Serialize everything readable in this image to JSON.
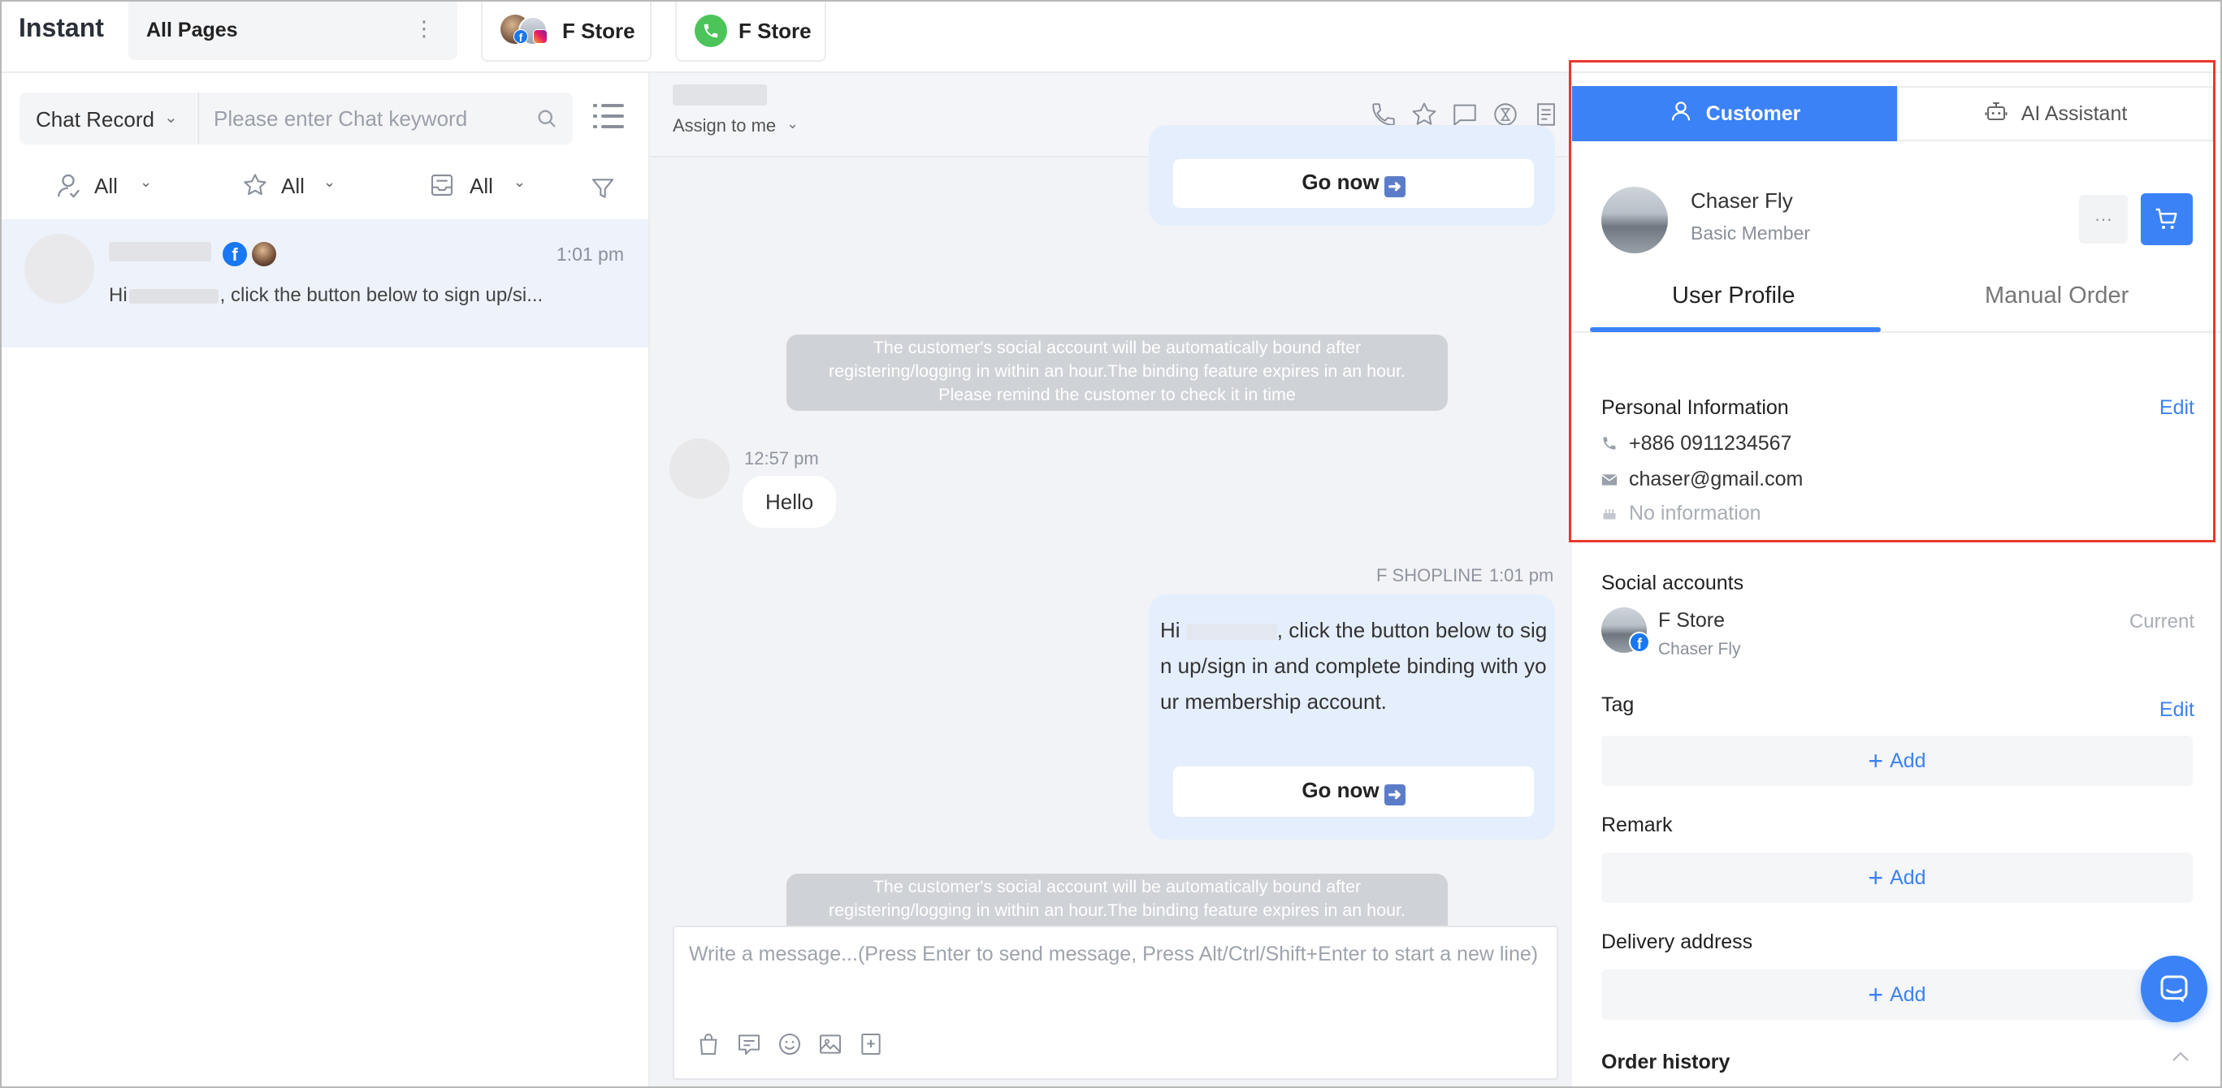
{
  "app": {
    "title": "Instant"
  },
  "page_selector": {
    "label": "All Pages",
    "more": "⋮"
  },
  "store_tabs": [
    {
      "label": "F Store",
      "channels": [
        "facebook",
        "instagram"
      ]
    },
    {
      "label": "F Store",
      "channels": [
        "whatsapp"
      ]
    }
  ],
  "sidebar": {
    "mode_select": "Chat Record",
    "search": {
      "placeholder": "Please enter Chat keyword",
      "value": ""
    },
    "filters": [
      {
        "icon": "user-icon",
        "label": "All"
      },
      {
        "icon": "star-icon",
        "label": "All"
      },
      {
        "icon": "inbox-icon",
        "label": "All"
      }
    ],
    "conversations": [
      {
        "time": "1:01 pm",
        "preview_prefix": "Hi",
        "preview_suffix": ", click the button below to sign up/si..."
      }
    ]
  },
  "chat": {
    "assign_label": "Assign to me",
    "header_icons": [
      "phone-icon",
      "star-icon",
      "message-icon",
      "clock-icon",
      "notes-icon"
    ],
    "go_now_label": "Go now",
    "system_note": {
      "line1": "The customer's social account will be automatically bound after",
      "line2": "registering/logging in within an hour.The binding feature expires in an hour.",
      "line3": "Please remind the customer to check it in time"
    },
    "incoming": {
      "time": "12:57 pm",
      "text": "Hello"
    },
    "outgoing": {
      "sender": "F SHOPLINE",
      "time": "1:01 pm",
      "line1_prefix": "Hi",
      "line1_suffix": ", click the button below to sig",
      "line2": "n up/sign in and complete binding with yo",
      "line3": "ur membership account."
    },
    "composer": {
      "placeholder": "Write a message...(Press Enter to send message, Press Alt/Ctrl/Shift+Enter to start a new line)",
      "tools": [
        "bag-icon",
        "quick-reply-icon",
        "emoji-icon",
        "image-icon",
        "bookmark-icon"
      ]
    }
  },
  "right_panel": {
    "tabs": [
      {
        "label": "Customer",
        "active": true
      },
      {
        "label": "AI Assistant",
        "active": false
      }
    ],
    "profile": {
      "name": "Chaser Fly",
      "level": "Basic Member",
      "more": "···"
    },
    "subtabs": [
      {
        "label": "User Profile",
        "active": true
      },
      {
        "label": "Manual Order",
        "active": false
      }
    ],
    "personal": {
      "heading": "Personal Information",
      "edit": "Edit",
      "phone": "+886 0911234567",
      "email": "chaser@gmail.com",
      "birthday": "No information"
    },
    "social": {
      "heading": "Social accounts",
      "items": [
        {
          "store": "F Store",
          "name": "Chaser Fly",
          "status": "Current"
        }
      ]
    },
    "tag": {
      "heading": "Tag",
      "edit": "Edit",
      "add": "Add"
    },
    "remark": {
      "heading": "Remark",
      "add": "Add"
    },
    "delivery": {
      "heading": "Delivery address",
      "add": "Add"
    },
    "order_history": {
      "heading": "Order history"
    }
  },
  "colors": {
    "accent": "#3b82f6",
    "highlight": "#e8382c",
    "facebook": "#1877f2",
    "whatsapp": "#4cc45a"
  }
}
